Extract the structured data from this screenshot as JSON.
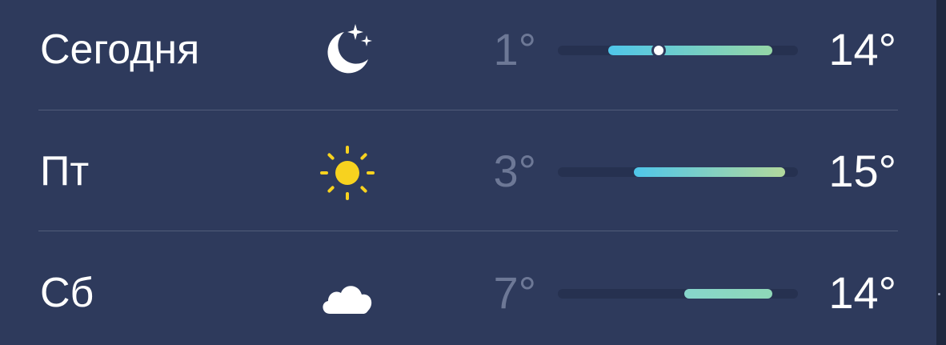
{
  "forecast": {
    "scale": {
      "min": -3,
      "max": 16
    },
    "days": [
      {
        "label": "Сегодня",
        "icon": "moon-stars-icon",
        "low": "1°",
        "high": "14°",
        "range_low": 1,
        "range_high": 14,
        "current": 5,
        "gradient": [
          "#4fc6ea",
          "#95d6a6"
        ]
      },
      {
        "label": "Пт",
        "icon": "sun-icon",
        "low": "3°",
        "high": "15°",
        "range_low": 3,
        "range_high": 15,
        "gradient": [
          "#4fc6ea",
          "#b2d89c"
        ]
      },
      {
        "label": "Сб",
        "icon": "cloud-icon",
        "low": "7°",
        "high": "14°",
        "range_low": 7,
        "range_high": 14,
        "gradient": [
          "#86d6cc",
          "#8fd8b8"
        ]
      }
    ]
  },
  "colors": {
    "background": "#2e3a5c",
    "divider": "#515c7a",
    "low_temp_text": "#6d7896",
    "track": "#263150",
    "sun": "#f7d21f"
  }
}
